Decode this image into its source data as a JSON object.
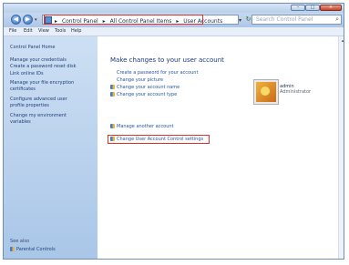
{
  "window": {
    "min_symbol": "–",
    "max_symbol": "□",
    "close_symbol": "×"
  },
  "nav": {
    "back_symbol": "◀",
    "forward_symbol": "▶",
    "recent_symbol": "▾",
    "breadcrumbs": [
      "Control Panel",
      "All Control Panel Items",
      "User Accounts"
    ],
    "separator": "▸",
    "address_dropdown_symbol": "▾",
    "refresh_symbol": "↻",
    "search_placeholder": "Search Control Panel",
    "search_symbol": "⌕"
  },
  "menu": [
    "File",
    "Edit",
    "View",
    "Tools",
    "Help"
  ],
  "sidebar": {
    "links": [
      "Control Panel Home",
      "Manage your credentials",
      "Create a password reset disk",
      "Link online IDs",
      "Manage your file encryption",
      "certificates",
      "Configure advanced user",
      "profile properties",
      "Change my environment",
      "variables"
    ],
    "see_also": "See also",
    "parental": "Parental Controls"
  },
  "main": {
    "heading": "Make changes to your user account",
    "tasks": [
      {
        "label": "Create a password for your account",
        "icon": "none"
      },
      {
        "label": "Change your picture",
        "icon": "none"
      },
      {
        "label": "Change your account name",
        "icon": "shield"
      },
      {
        "label": "Change your account type",
        "icon": "shield"
      }
    ],
    "tasks2": [
      {
        "label": "Manage another account",
        "icon": "shield"
      },
      {
        "label": "Change User Account Control settings",
        "icon": "shield"
      }
    ],
    "user": {
      "name": "admin",
      "role": "Administrator"
    }
  },
  "scroll_up_symbol": "▴"
}
